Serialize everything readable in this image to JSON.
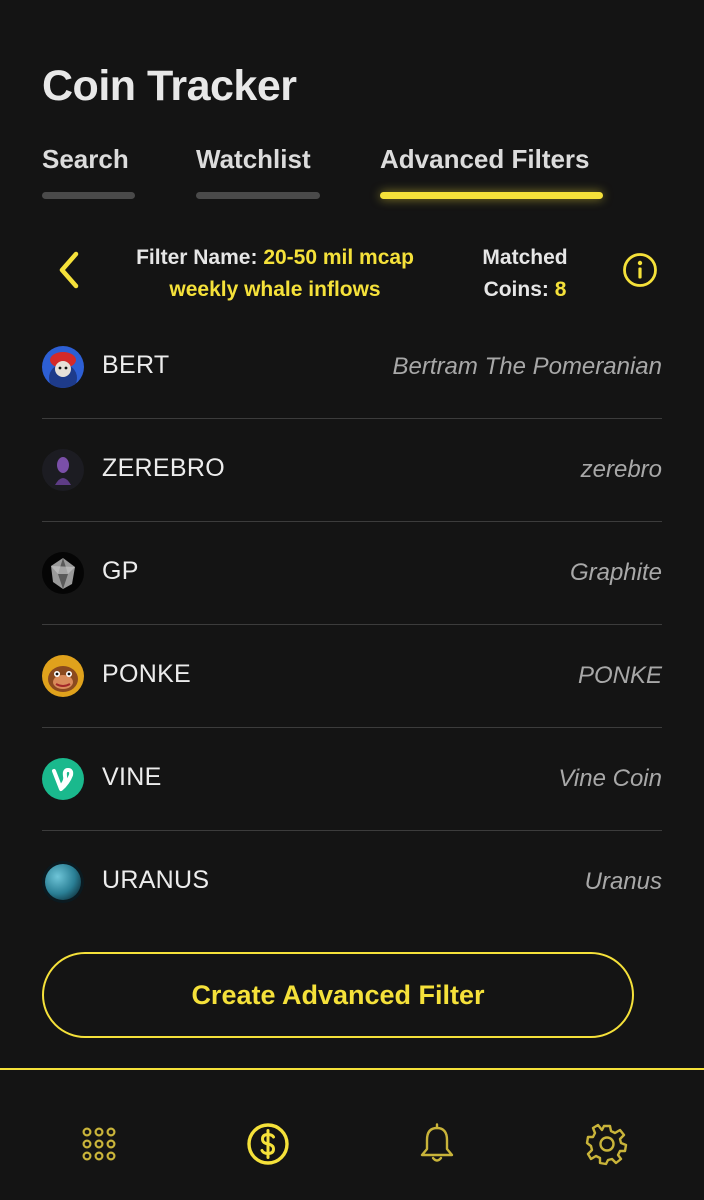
{
  "app": {
    "title": "Coin Tracker"
  },
  "tabs": [
    {
      "label": "Search",
      "active": false
    },
    {
      "label": "Watchlist",
      "active": false
    },
    {
      "label": "Advanced Filters",
      "active": true
    }
  ],
  "filter": {
    "name_label": "Filter Name:",
    "name_value_line1": "20-50 mil mcap",
    "name_value_line2": "weekly whale inflows",
    "matched_label_line1": "Matched",
    "matched_label_line2": "Coins:",
    "matched_count": "8"
  },
  "coins": [
    {
      "symbol": "BERT",
      "name": "Bertram The Pomeranian",
      "icon": "bert-avatar"
    },
    {
      "symbol": "ZEREBRO",
      "name": "zerebro",
      "icon": "zerebro-avatar"
    },
    {
      "symbol": "GP",
      "name": "Graphite",
      "icon": "graphite-avatar"
    },
    {
      "symbol": "PONKE",
      "name": "PONKE",
      "icon": "ponke-avatar"
    },
    {
      "symbol": "VINE",
      "name": "Vine Coin",
      "icon": "vine-avatar"
    },
    {
      "symbol": "URANUS",
      "name": "Uranus",
      "icon": "uranus-avatar"
    }
  ],
  "create_button": {
    "label": "Create Advanced Filter"
  },
  "nav": [
    {
      "icon": "grid-icon",
      "active": false
    },
    {
      "icon": "dollar-coin-icon",
      "active": true
    },
    {
      "icon": "bell-icon",
      "active": false
    },
    {
      "icon": "gear-icon",
      "active": false
    }
  ],
  "colors": {
    "accent": "#f5e13a",
    "background": "#141414",
    "text": "#e8e8e8",
    "muted": "#a8a8a8",
    "divider": "#3c3c3c"
  }
}
